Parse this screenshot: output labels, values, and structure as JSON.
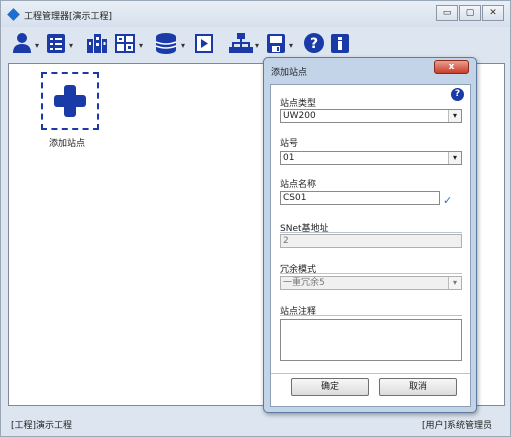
{
  "window": {
    "title": "工程管理器[演示工程]",
    "controls": [
      "▭",
      "▢",
      "✕"
    ]
  },
  "toolbar": {
    "items": [
      {
        "icon": "user-icon",
        "has_dropdown": true
      },
      {
        "icon": "list-icon",
        "has_dropdown": true
      },
      {
        "icon": "building-icon",
        "has_dropdown": false
      },
      {
        "icon": "config-icon",
        "has_dropdown": true
      },
      {
        "icon": "database-icon",
        "has_dropdown": true
      },
      {
        "icon": "play-icon",
        "has_dropdown": false
      },
      {
        "icon": "network-icon",
        "has_dropdown": true
      },
      {
        "icon": "save-icon",
        "has_dropdown": true
      },
      {
        "icon": "help-icon",
        "has_dropdown": false
      },
      {
        "icon": "info-icon",
        "has_dropdown": false
      }
    ]
  },
  "workspace": {
    "add_site_label": "添加站点"
  },
  "statusbar": {
    "left": "[工程]演示工程",
    "right": "[用户]系统管理员"
  },
  "dialog": {
    "title": "添加站点",
    "close_label": "x",
    "help_label": "?",
    "station_type_label": "站点类型",
    "station_type_value": "UW200",
    "station_no_label": "站号",
    "station_no_value": "01",
    "station_name_label": "站点名称",
    "station_name_value": "CS01",
    "snet_label": "SNet基地址",
    "snet_value": "2",
    "redundancy_label": "冗余模式",
    "redundancy_value": "一重冗余5",
    "note_label": "站点注释",
    "note_value": "",
    "ok_label": "确定",
    "cancel_label": "取消",
    "check_mark": "✓"
  },
  "colors": {
    "icon_blue": "#1a3aa8",
    "accent": "#2a6fd0",
    "close_red": "#c73e2b"
  }
}
